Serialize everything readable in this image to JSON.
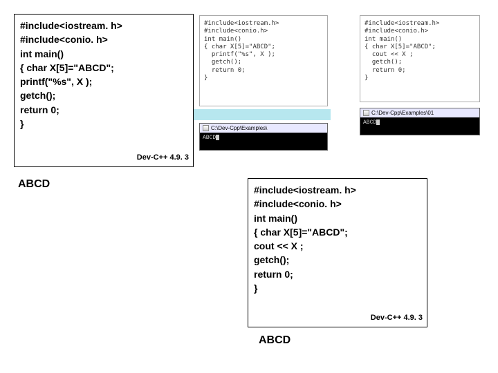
{
  "box1": {
    "lines": [
      "#include<iostream. h>",
      "#include<conio. h>",
      "int main()",
      "{ char X[5]=\"ABCD\";",
      "  printf(\"%s\", X );",
      "  getch();",
      "  return 0;",
      "}"
    ],
    "dev_label": "Dev-C++ 4.9. 3",
    "output": "ABCD"
  },
  "box2": {
    "lines": [
      "#include<iostream. h>",
      "#include<conio. h>",
      "int main()",
      "{ char X[5]=\"ABCD\";",
      "  cout << X ;",
      "  getch();",
      "  return 0;",
      "}"
    ],
    "dev_label": "Dev-C++ 4.9. 3",
    "output": "ABCD"
  },
  "editor1": {
    "text": "#include<iostream.h>\n#include<conio.h>\nint main()\n{ char X[5]=\"ABCD\";\n  printf(\"%s\", X );\n  getch();\n  return 0;\n}"
  },
  "editor2": {
    "text": "#include<iostream.h>\n#include<conio.h>\nint main()\n{ char X[5]=\"ABCD\";\n  cout << X ;\n  getch();\n  return 0;\n}"
  },
  "console1": {
    "title": "C:\\Dev-Cpp\\Examples\\",
    "output": "ABCD"
  },
  "console2": {
    "title": "C:\\Dev-Cpp\\Examples\\01",
    "output": "ABCD"
  }
}
